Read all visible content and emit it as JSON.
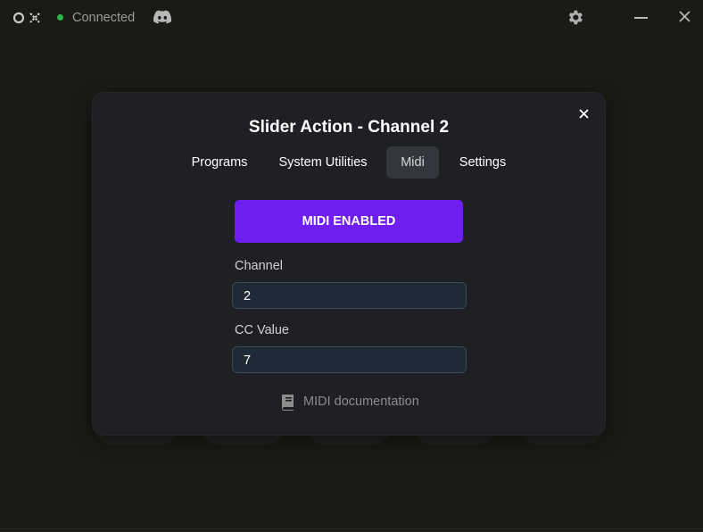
{
  "titlebar": {
    "status": "Connected",
    "colors": {
      "status_dot": "#2fb34a"
    },
    "icons": [
      "app-logo-icon",
      "discord-icon",
      "gear-icon",
      "minimize-icon",
      "close-icon"
    ]
  },
  "modal": {
    "title": "Slider Action - Channel 2",
    "tabs": [
      {
        "label": "Programs",
        "active": false
      },
      {
        "label": "System Utilities",
        "active": false
      },
      {
        "label": "Midi",
        "active": true
      },
      {
        "label": "Settings",
        "active": false
      }
    ],
    "midi_button": "MIDI ENABLED",
    "channel_label": "Channel",
    "channel_value": "2",
    "cc_label": "CC Value",
    "cc_value": "7",
    "doc_link": "MIDI documentation",
    "colors": {
      "accent": "#6e1ef0",
      "active_tab": "#32363d",
      "input_bg": "#1f2a37"
    }
  }
}
